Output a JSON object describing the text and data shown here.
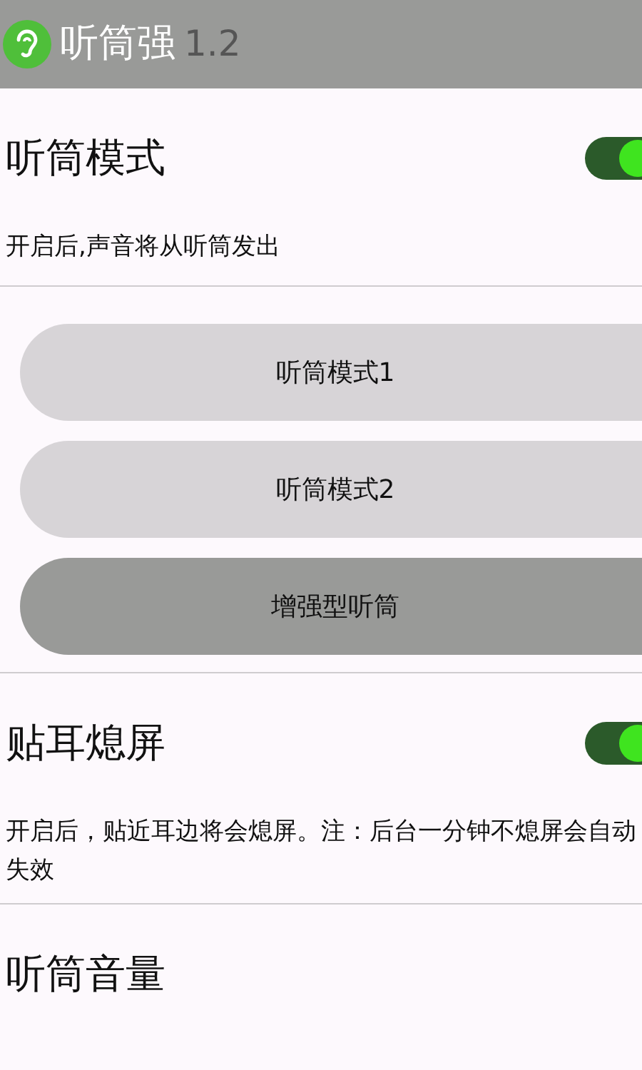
{
  "app_bar": {
    "title": "听筒强",
    "version": "1.2"
  },
  "sections": [
    {
      "kind": "switch",
      "title": "听筒模式",
      "on": true,
      "description": "开启后,声音将从听筒发出",
      "buttons": [
        {
          "label": "听筒模式1",
          "selected": false
        },
        {
          "label": "听筒模式2",
          "selected": false
        },
        {
          "label": "增强型听筒",
          "selected": true
        }
      ]
    },
    {
      "kind": "switch",
      "title": "贴耳熄屏",
      "on": true,
      "description": "开启后，贴近耳边将会熄屏。注：后台一分钟不熄屏会自动失效"
    },
    {
      "kind": "heading",
      "title": "听筒音量"
    }
  ]
}
